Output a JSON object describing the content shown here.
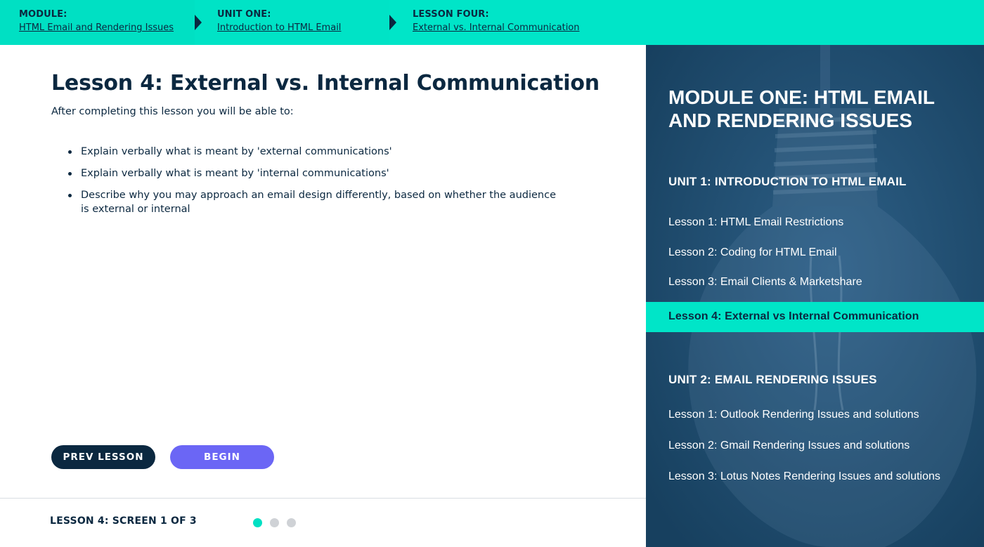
{
  "breadcrumbs": [
    {
      "title": "MODULE:",
      "link": "HTML Email and Rendering Issues"
    },
    {
      "title": "UNIT ONE:",
      "link": "Introduction to HTML Email"
    },
    {
      "title": "LESSON FOUR:",
      "link": "External vs. Internal Communication"
    }
  ],
  "main": {
    "title": "Lesson 4: External vs. Internal Communication",
    "intro": "After completing this lesson you will be able to:",
    "objectives": [
      "Explain verbally what is meant by 'external communications'",
      "Explain verbally what is meant by 'internal communications'",
      "Describe why you may approach an email design differently, based on whether the audience is external or internal"
    ],
    "prev_label": "PREV LESSON",
    "begin_label": "BEGIN",
    "screen_label": "LESSON 4: SCREEN 1 OF 3",
    "screens": {
      "current": 1,
      "total": 3
    }
  },
  "sidebar": {
    "module_title": "MODULE ONE: HTML EMAIL AND RENDERING ISSUES",
    "units": [
      {
        "title": "UNIT 1: INTRODUCTION TO HTML EMAIL",
        "lessons": [
          "Lesson 1: HTML Email Restrictions",
          "Lesson 2: Coding for HTML Email",
          "Lesson 3: Email Clients & Marketshare",
          "Lesson 4: External vs Internal Communication"
        ],
        "active_lesson": 3
      },
      {
        "title": "UNIT 2: EMAIL RENDERING ISSUES",
        "lessons": [
          "Lesson 1: Outlook Rendering Issues and solutions",
          "Lesson 2: Gmail Rendering Issues and solutions",
          "Lesson 3: Lotus Notes Rendering Issues and solutions"
        ]
      }
    ]
  },
  "colors": {
    "accent": "#00e5c8",
    "navy": "#0b2840",
    "sidebar": "#1c4a6e",
    "begin_button": "#6b66f5"
  }
}
